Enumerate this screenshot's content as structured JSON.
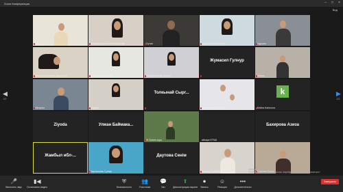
{
  "window": {
    "title": "Zoom Конференция",
    "view_label": "Вид"
  },
  "participants": [
    {
      "name": "Айару",
      "type": "video"
    },
    {
      "name": "Жумабек Рэльсе Жанарбекова",
      "type": "video"
    },
    {
      "name": "Сутан",
      "type": "video"
    },
    {
      "name": "Удельбаева Альбина",
      "type": "video"
    },
    {
      "name": "Нургуль",
      "type": "video"
    },
    {
      "name": "Магжан Кенжебек Нурсултан",
      "type": "video"
    },
    {
      "name": "Донна Мирзададие",
      "type": "video"
    },
    {
      "name": "Абдимаженова Ахмед",
      "type": "video"
    },
    {
      "name": "Жумасил Гулнур",
      "type": "text"
    },
    {
      "name": "Ислам",
      "type": "video"
    },
    {
      "name": "Айгерим",
      "type": "video"
    },
    {
      "name": "Айдана",
      "type": "video"
    },
    {
      "name": "Толкынай Сырг...",
      "type": "text"
    },
    {
      "name": "Кенжегалиева Айдана",
      "type": "video"
    },
    {
      "name": "Бейна Karimova",
      "type": "logo",
      "logo_letter": "k"
    },
    {
      "name": "Ziyoda",
      "type": "text"
    },
    {
      "name": "Улжан Баймака...",
      "type": "text"
    },
    {
      "name": "Ж Ермек оқуш",
      "type": "video"
    },
    {
      "name": "айсара KTMA",
      "type": "text_small"
    },
    {
      "name": "Бахирова Азиза",
      "type": "text"
    },
    {
      "name": "Жамбыл ибл-...",
      "type": "text"
    },
    {
      "name": "Картаньева Гүлнар",
      "type": "video"
    },
    {
      "name": "Даутова Сенім",
      "type": "text"
    },
    {
      "name": "Рамина Кудайберг",
      "type": "video"
    },
    {
      "name": "Сахиева Ерлан",
      "type": "video"
    }
  ],
  "pagination": {
    "left": "1/2",
    "right": "1/2"
  },
  "toolbar": {
    "unmute": "Включить звук",
    "stop_video": "Остановить видео",
    "security": "Безопасность",
    "participants": "Участники",
    "participants_count": "25",
    "chat": "Чат",
    "share": "Демонстрация экрана",
    "record": "Запись",
    "reactions": "Реакции",
    "more": "Дополнительно",
    "end": "Завершить"
  },
  "activation": {
    "line1": "Активация Windows",
    "line2": "Чтобы активировать Windows, перейдите в раздел \"Параметры\""
  },
  "clock": {
    "time": "09:41",
    "date": "26.02.2021"
  }
}
